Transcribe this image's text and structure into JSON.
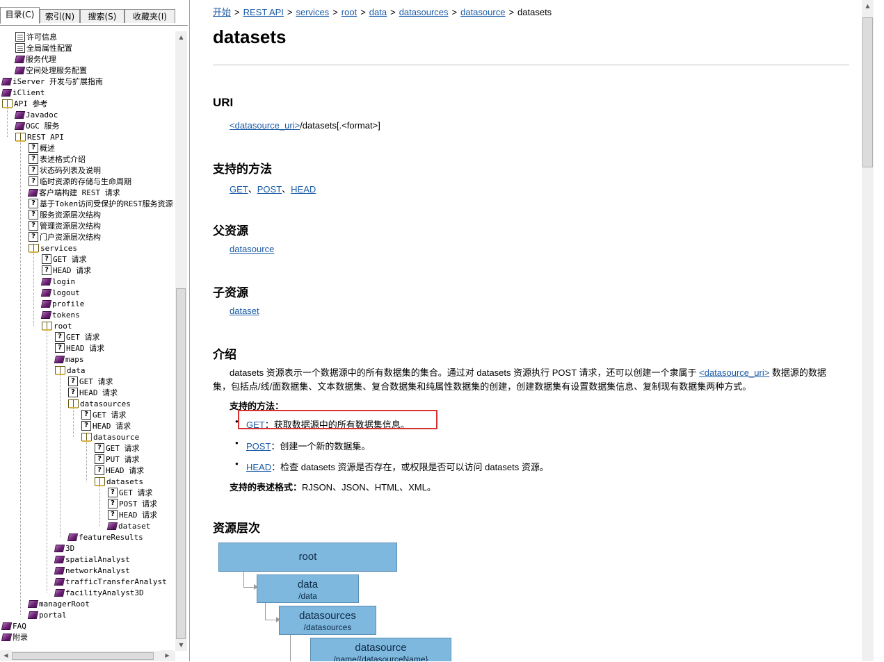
{
  "tabs": [
    {
      "label": "目录(C)",
      "active": true
    },
    {
      "label": "索引(N)",
      "active": false
    },
    {
      "label": "搜索(S)",
      "active": false
    },
    {
      "label": "收藏夹(I)",
      "active": false
    }
  ],
  "tree": [
    {
      "label": "许可信息",
      "icon": "page",
      "depth": 1
    },
    {
      "label": "全局属性配置",
      "icon": "page",
      "depth": 1
    },
    {
      "label": "服务代理",
      "icon": "book",
      "depth": 1
    },
    {
      "label": "空间处理服务配置",
      "icon": "book",
      "depth": 1
    },
    {
      "label": "iServer 开发与扩展指南",
      "icon": "book",
      "depth": 0
    },
    {
      "label": "iClient",
      "icon": "book",
      "depth": 0
    },
    {
      "label": "API 参考",
      "icon": "open",
      "depth": 0
    },
    {
      "label": "Javadoc",
      "icon": "book",
      "depth": 1
    },
    {
      "label": "OGC 服务",
      "icon": "book",
      "depth": 1
    },
    {
      "label": "REST API",
      "icon": "open",
      "depth": 1
    },
    {
      "label": "概述",
      "icon": "q",
      "depth": 2
    },
    {
      "label": "表述格式介绍",
      "icon": "q",
      "depth": 2
    },
    {
      "label": "状态码列表及说明",
      "icon": "q",
      "depth": 2
    },
    {
      "label": "临时资源的存储与生命周期",
      "icon": "q",
      "depth": 2
    },
    {
      "label": "客户端构建 REST 请求",
      "icon": "book",
      "depth": 2
    },
    {
      "label": "基于Token访问受保护的REST服务资源",
      "icon": "q",
      "depth": 2
    },
    {
      "label": "服务资源层次结构",
      "icon": "q",
      "depth": 2
    },
    {
      "label": "管理资源层次结构",
      "icon": "q",
      "depth": 2
    },
    {
      "label": "门户资源层次结构",
      "icon": "q",
      "depth": 2
    },
    {
      "label": "services",
      "icon": "open",
      "depth": 2
    },
    {
      "label": "GET 请求",
      "icon": "q",
      "depth": 3
    },
    {
      "label": "HEAD 请求",
      "icon": "q",
      "depth": 3
    },
    {
      "label": "login",
      "icon": "book",
      "depth": 3
    },
    {
      "label": "logout",
      "icon": "book",
      "depth": 3
    },
    {
      "label": "profile",
      "icon": "book",
      "depth": 3
    },
    {
      "label": "tokens",
      "icon": "book",
      "depth": 3
    },
    {
      "label": "root",
      "icon": "open",
      "depth": 3
    },
    {
      "label": "GET 请求",
      "icon": "q",
      "depth": 4
    },
    {
      "label": "HEAD 请求",
      "icon": "q",
      "depth": 4
    },
    {
      "label": "maps",
      "icon": "book",
      "depth": 4
    },
    {
      "label": "data",
      "icon": "open",
      "depth": 4
    },
    {
      "label": "GET 请求",
      "icon": "q",
      "depth": 5
    },
    {
      "label": "HEAD 请求",
      "icon": "q",
      "depth": 5
    },
    {
      "label": "datasources",
      "icon": "open",
      "depth": 5
    },
    {
      "label": "GET 请求",
      "icon": "q",
      "depth": 6
    },
    {
      "label": "HEAD 请求",
      "icon": "q",
      "depth": 6
    },
    {
      "label": "datasource",
      "icon": "open",
      "depth": 6
    },
    {
      "label": "GET 请求",
      "icon": "q",
      "depth": 7
    },
    {
      "label": "PUT 请求",
      "icon": "q",
      "depth": 7
    },
    {
      "label": "HEAD 请求",
      "icon": "q",
      "depth": 7
    },
    {
      "label": "datasets",
      "icon": "open",
      "depth": 7
    },
    {
      "label": "GET 请求",
      "icon": "q",
      "depth": 8
    },
    {
      "label": "POST 请求",
      "icon": "q",
      "depth": 8
    },
    {
      "label": "HEAD 请求",
      "icon": "q",
      "depth": 8
    },
    {
      "label": "dataset",
      "icon": "book",
      "depth": 8
    },
    {
      "label": "featureResults",
      "icon": "book",
      "depth": 5
    },
    {
      "label": "3D",
      "icon": "book",
      "depth": 4
    },
    {
      "label": "spatialAnalyst",
      "icon": "book",
      "depth": 4
    },
    {
      "label": "networkAnalyst",
      "icon": "book",
      "depth": 4
    },
    {
      "label": "trafficTransferAnalyst",
      "icon": "book",
      "depth": 4
    },
    {
      "label": "facilityAnalyst3D",
      "icon": "book",
      "depth": 4
    },
    {
      "label": "managerRoot",
      "icon": "book",
      "depth": 2
    },
    {
      "label": "portal",
      "icon": "book",
      "depth": 2
    },
    {
      "label": "FAQ",
      "icon": "book",
      "depth": 0
    },
    {
      "label": "附录",
      "icon": "book",
      "depth": 0
    }
  ],
  "breadcrumb": {
    "links": [
      "开始",
      "REST API",
      "services",
      "root",
      "data",
      "datasources",
      "datasource"
    ],
    "separator": ">",
    "current": "datasets"
  },
  "page_title": "datasets",
  "uri": {
    "title": "URI",
    "link": "<datasource_uri>",
    "rest": "/datasets[.<format>]"
  },
  "methods": {
    "title": "支持的方法",
    "links": [
      "GET",
      "POST",
      "HEAD"
    ],
    "sep": "、"
  },
  "parent": {
    "title": "父资源",
    "link": "datasource"
  },
  "child": {
    "title": "子资源",
    "link": "dataset"
  },
  "intro": {
    "title": "介绍",
    "text_a": "datasets 资源表示一个数据源中的所有数据集的集合。通过对 datasets 资源执行 POST 请求，还可以创建一个隶属于 ",
    "text_link": "<datasource_uri>",
    "text_b": " 数据源的数据集，包括点/线/面数据集、文本数据集、复合数据集和纯属性数据集的创建，创建数据集有设置数据集信息、复制现有数据集两种方式。",
    "methods_label": "支持的方法：",
    "bullets": [
      {
        "link": "GET",
        "text": "：获取数据源中的所有数据集信息。"
      },
      {
        "link": "POST",
        "text": "：创建一个新的数据集。"
      },
      {
        "link": "HEAD",
        "text": "：检查 datasets 资源是否存在，或权限是否可以访问 datasets 资源。"
      }
    ],
    "formats_label": "支持的表述格式：",
    "formats_value": "RJSON、JSON、HTML、XML。"
  },
  "hierarchy": {
    "title": "资源层次",
    "nodes": [
      {
        "name": "root",
        "path": ""
      },
      {
        "name": "data",
        "path": "/data"
      },
      {
        "name": "datasources",
        "path": "/datasources"
      },
      {
        "name": "datasource",
        "path": "/name/{datasourceName}"
      }
    ]
  },
  "colors": {
    "link": "#1a5aa6",
    "highlight": "#d93030",
    "node_fill": "#7fb8de"
  }
}
